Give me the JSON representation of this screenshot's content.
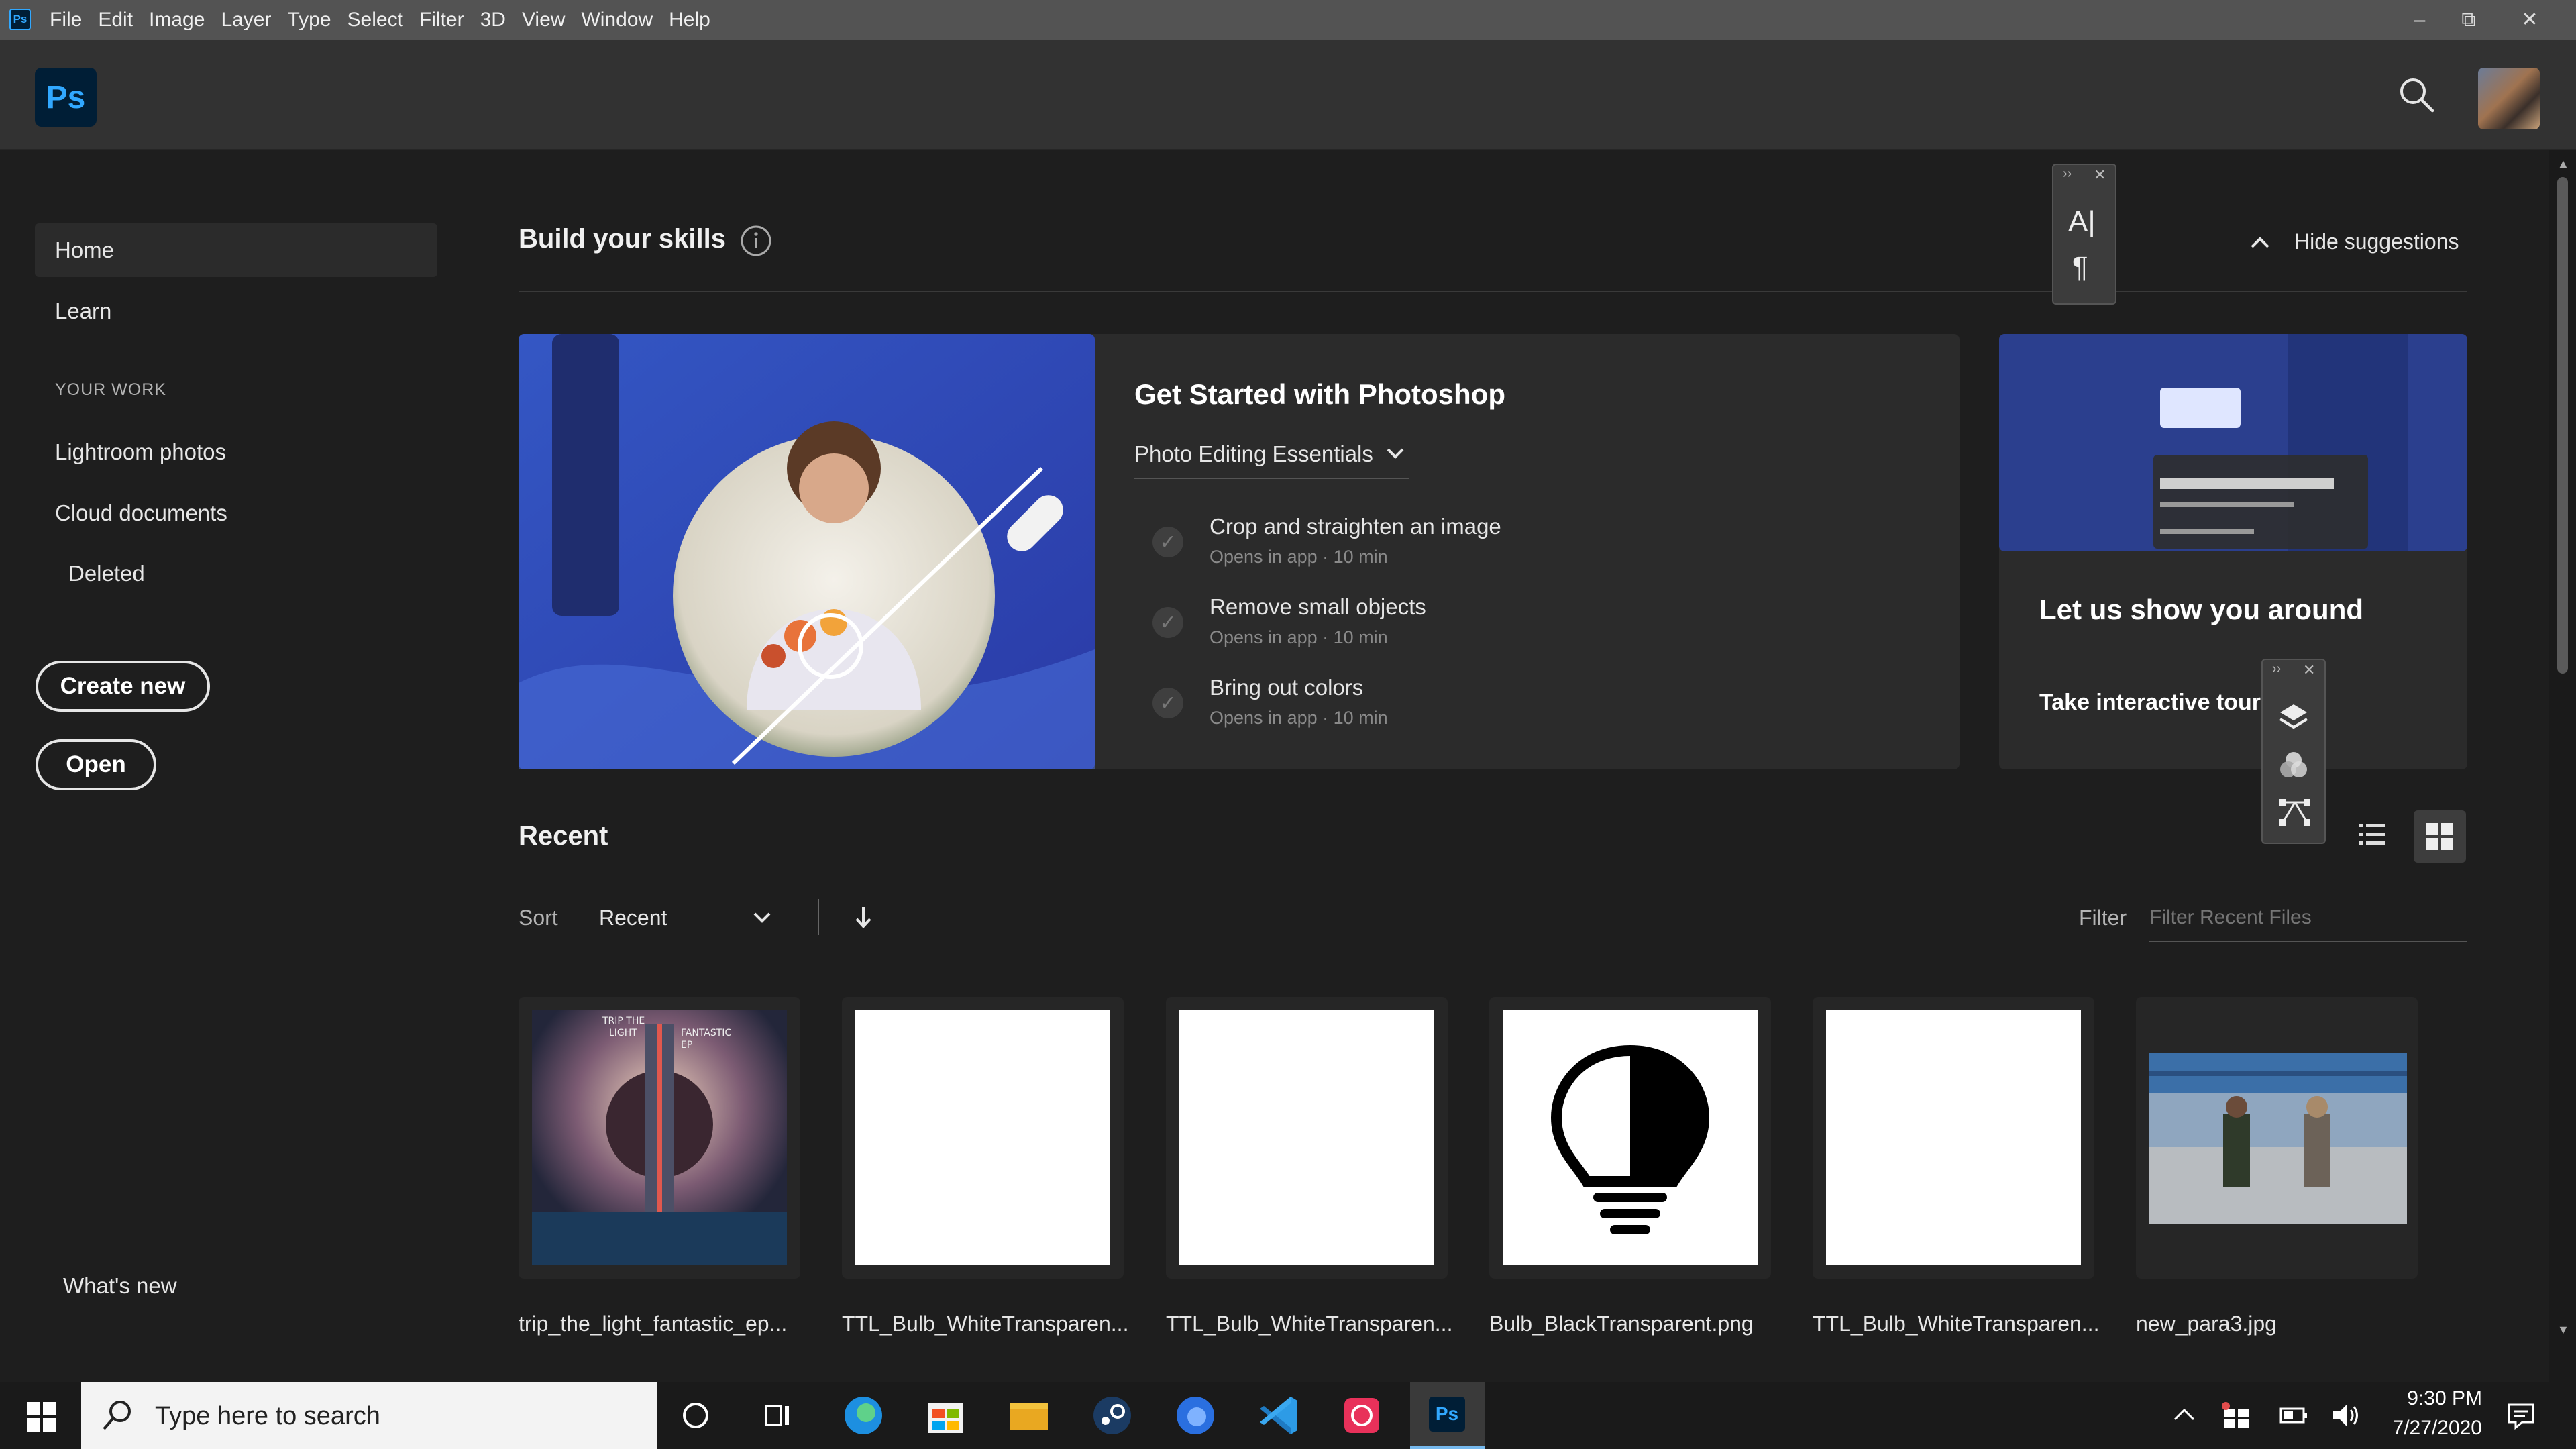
{
  "menubar": {
    "app_icon": "Ps",
    "items": [
      "File",
      "Edit",
      "Image",
      "Layer",
      "Type",
      "Select",
      "Filter",
      "3D",
      "View",
      "Window",
      "Help"
    ],
    "controls": [
      "–",
      "⧉",
      "✕"
    ]
  },
  "header": {
    "logo": "Ps"
  },
  "sidebar": {
    "home": "Home",
    "learn": "Learn",
    "section": "YOUR WORK",
    "lightroom": "Lightroom photos",
    "cloud": "Cloud documents",
    "deleted": "Deleted",
    "create_new": "Create new",
    "open": "Open",
    "whats_new": "What's new"
  },
  "skills": {
    "title": "Build your skills",
    "hide": "Hide suggestions",
    "card_title": "Get Started with Photoshop",
    "dropdown": "Photo Editing Essentials",
    "lessons": [
      {
        "title": "Crop and straighten an image",
        "meta": "Opens in app · 10 min"
      },
      {
        "title": "Remove small objects",
        "meta": "Opens in app · 10 min"
      },
      {
        "title": "Bring out colors",
        "meta": "Opens in app · 10 min"
      }
    ],
    "tour_title": "Let us show you around",
    "tour_link": "Take interactive tour"
  },
  "floating_panel_1": {
    "glyph_a": "A|",
    "glyph_b": "¶"
  },
  "recent": {
    "title": "Recent",
    "sort_label": "Sort",
    "sort_value": "Recent",
    "filter_label": "Filter",
    "filter_placeholder": "Filter Recent Files",
    "files": [
      {
        "name": "trip_the_light_fantastic_ep...",
        "art_lines": [
          "TRIP THE",
          "LIGHT",
          "FANTASTIC",
          "EP"
        ]
      },
      {
        "name": "TTL_Bulb_WhiteTransparen..."
      },
      {
        "name": "TTL_Bulb_WhiteTransparen..."
      },
      {
        "name": "Bulb_BlackTransparent.png"
      },
      {
        "name": "TTL_Bulb_WhiteTransparen..."
      },
      {
        "name": "new_para3.jpg"
      }
    ]
  },
  "taskbar": {
    "search_placeholder": "Type here to search",
    "time": "9:30 PM",
    "date": "7/27/2020",
    "ps_label": "Ps"
  }
}
